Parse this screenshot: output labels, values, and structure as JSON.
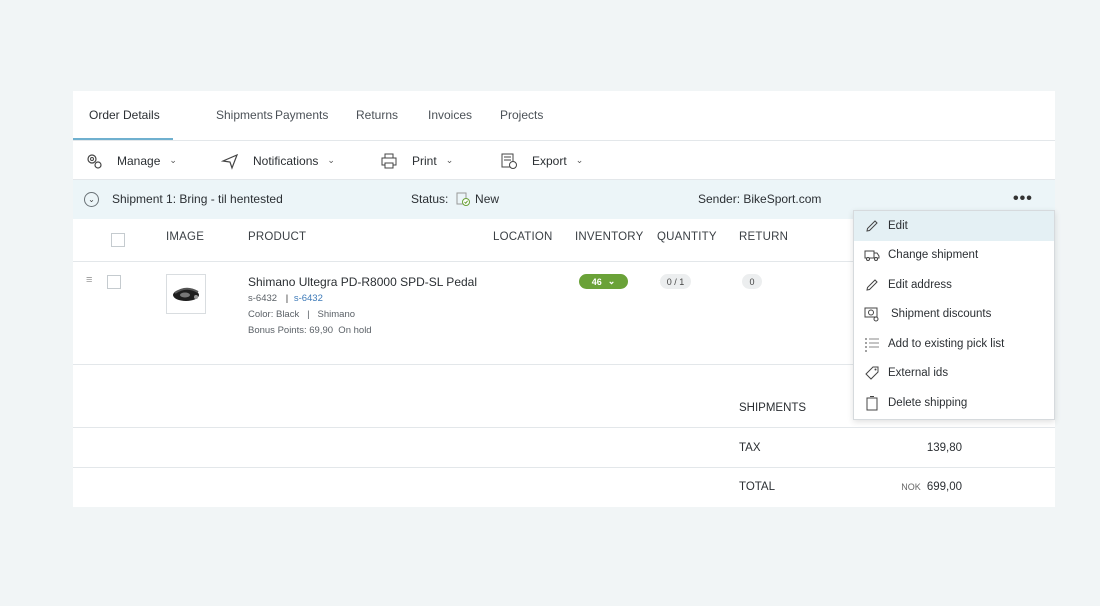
{
  "tabs": [
    "Order Details",
    "Shipments",
    "Payments",
    "Returns",
    "Invoices",
    "Projects"
  ],
  "toolbar": {
    "manage": "Manage",
    "notifications": "Notifications",
    "print": "Print",
    "export": "Export"
  },
  "shipment": {
    "title": "Shipment 1: Bring - til hentested",
    "status_label": "Status:",
    "status_value": "New",
    "sender": "Sender: BikeSport.com",
    "more": "•••"
  },
  "columns": {
    "image": "IMAGE",
    "product": "PRODUCT",
    "location": "LOCATION",
    "inventory": "INVENTORY",
    "quantity": "QUANTITY",
    "return": "RETURN"
  },
  "item": {
    "name": "Shimano Ultegra PD-R8000 SPD-SL Pedal",
    "sku": "s-6432",
    "sku_link": "s-6432",
    "attributes": "Color: Black   |   Shimano",
    "bonus": "Bonus Points: 69,90  On hold",
    "inventory": "46",
    "quantity": "0 / 1",
    "return": "0"
  },
  "summary": {
    "shipments_label": "SHIPMENTS",
    "tax_label": "TAX",
    "tax_value": "139,80",
    "total_label": "TOTAL",
    "currency": "NOK",
    "total_value": "699,00"
  },
  "menu": [
    "Edit",
    "Change shipment",
    "Edit address",
    "Shipment discounts",
    "Add to existing pick list",
    "External ids",
    "Delete shipping"
  ],
  "colors": {
    "accent": "#6fb0cf",
    "inventory_badge": "#6aa238",
    "header_bg": "#ecf5f8",
    "link": "#3d7ab8"
  }
}
